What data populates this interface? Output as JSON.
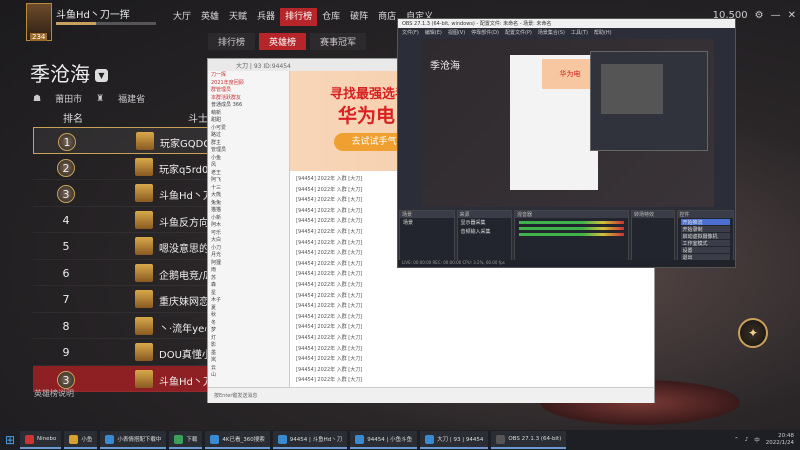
{
  "game": {
    "player_name": "斗鱼Hd丶刀一挥",
    "player_level": "234",
    "nav": [
      "大厅",
      "英雄",
      "天赋",
      "兵器",
      "排行榜",
      "仓库",
      "破阵",
      "商店",
      "自定义"
    ],
    "nav_active": 4,
    "subnav": [
      "排行榜",
      "英雄榜",
      "赛事冠军"
    ],
    "subnav_active": 1,
    "currency": "10,500",
    "region_title": "季沧海",
    "filter_city": "莆田市",
    "filter_province": "福建省",
    "col_rank": "排名",
    "col_player": "斗士",
    "rows": [
      {
        "rank": "1",
        "name": "玩家GQDG"
      },
      {
        "rank": "2",
        "name": "玩家q5rd00"
      },
      {
        "rank": "3",
        "name": "斗鱼Hd丶刀"
      },
      {
        "rank": "4",
        "name": "斗鱼反方向的"
      },
      {
        "rank": "5",
        "name": "嗯没意思的"
      },
      {
        "rank": "6",
        "name": "企鹅电竞/瓜"
      },
      {
        "rank": "7",
        "name": "重庆妹网恋"
      },
      {
        "rank": "8",
        "name": "丶·流年ye心"
      },
      {
        "rank": "9",
        "name": "DOU真懂小"
      },
      {
        "rank": "3",
        "name": "斗鱼Hd丶刀"
      }
    ],
    "legend": "英雄榜说明"
  },
  "qq": {
    "title": "大刀 | 93  ID:94454",
    "left_items": [
      "刀一挥",
      "2021年度回顾",
      "群管理员",
      "本群活跃群友",
      "普通成员 366",
      "萌新",
      "甜甜",
      "小可爱",
      "路过",
      "群主",
      "管理员",
      "小鱼",
      "风",
      "老王",
      "阿飞",
      "十三",
      "大熊",
      "兔兔",
      "猫猫",
      "小新",
      "阿木",
      "可乐",
      "大白",
      "小刀",
      "月光",
      "阿狸",
      "雨",
      "苏",
      "森",
      "星",
      "木子",
      "夏",
      "秋",
      "冬",
      "梦",
      "灯",
      "影",
      "墨",
      "岚",
      "云",
      "山"
    ],
    "banner_line1": "寻找最强选手",
    "banner_line2": "华为电",
    "banner_button": "去试试手气",
    "messages": [
      "[94454] 2022年 入群 [大刀]",
      "[94454] 2022年 入群 [大刀]",
      "[94454] 2022年 入群 [大刀]",
      "[94454] 2022年 入群 [大刀]",
      "[94454] 2022年 入群 [大刀]",
      "[94454] 2022年 入群 [大刀]",
      "[94454] 2022年 入群 [大刀]",
      "[94454] 2022年 入群 [大刀]",
      "[94454] 2022年 入群 [大刀]",
      "[94454] 2022年 入群 [大刀]",
      "[94454] 2022年 入群 [大刀]",
      "[94454] 2022年 入群 [大刀]",
      "[94454] 2022年 入群 [大刀]",
      "[94454] 2022年 入群 [大刀]",
      "[94454] 2022年 入群 [大刀]",
      "[94454] 2022年 入群 [大刀]",
      "[94454] 2022年 入群 [大刀]",
      "[94454] 2022年 入群 [大刀]",
      "[94454] 2022年 入群 [大刀]",
      "[94454] 2022年 入群 [大刀]"
    ],
    "input_hint": "按Enter键发送消息"
  },
  "obs": {
    "title": "OBS 27.1.3 (64-bit, windows) - 配置文件: 未命名 - 场景: 未命名",
    "menu": [
      "文件(F)",
      "编辑(E)",
      "视图(V)",
      "停靠部件(D)",
      "配置文件(P)",
      "场景集合(S)",
      "工具(T)",
      "帮助(H)"
    ],
    "preview_title": "季沧海",
    "preview_banner": "华为电",
    "docks": [
      "场景",
      "来源",
      "混音器",
      "转场特效",
      "控件"
    ],
    "scene": "场景",
    "sources": [
      "显示器采集",
      "音频输入采集"
    ],
    "controls": [
      "开始推流",
      "开始录制",
      "启动虚拟摄像机",
      "工作室模式",
      "设置",
      "退出"
    ],
    "status": "LIVE: 00:00:00   REC: 00:00:00   CPU: 3.2%, 60.00 fps"
  },
  "taskbar": {
    "items": [
      "Ninebo",
      "小鱼",
      "小表情搭配下载中",
      "下载",
      "4K已看_360搜索",
      "94454 | 斗鱼Hd丶刀",
      "94454 | 小鱼斗鱼",
      "大刀 | 93 | 94454",
      "OBS 27.1.3 (64-bit)"
    ],
    "item_colors": [
      "#c33",
      "#d9a030",
      "#3a8ad0",
      "#3aa05a",
      "#3a8ad0",
      "#3a8ad0",
      "#3a8ad0",
      "#3a8ad0",
      "#555"
    ],
    "time": "20:48",
    "date": "2022/1/24",
    "lang": "中"
  }
}
